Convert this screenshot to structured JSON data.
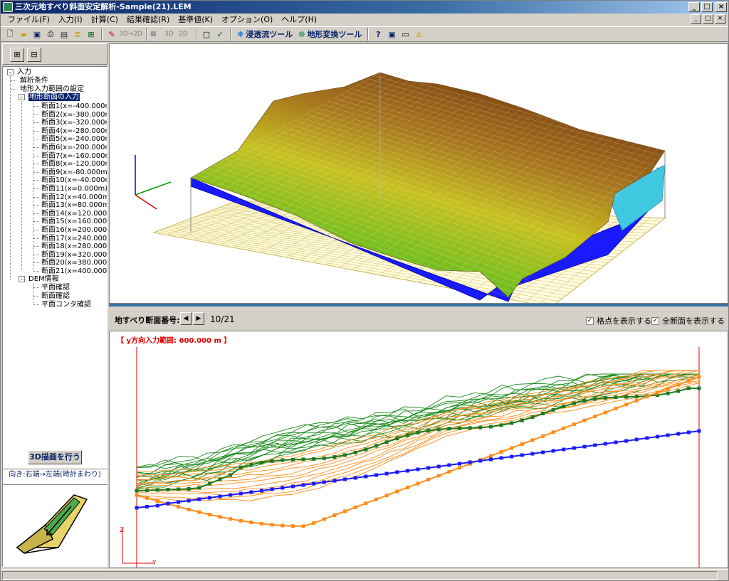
{
  "window": {
    "title": "三次元地すべり斜面安定解析-Sample(21).LEM"
  },
  "menu": [
    "ファイル(F)",
    "入力(I)",
    "計算(C)",
    "結果確認(R)",
    "基準値(K)",
    "オプション(O)",
    "ヘルプ(H)"
  ],
  "toolbar": {
    "seepage_tool": "浸透流ツール",
    "terrain_tool": "地形変換ツール",
    "view_3d2d": "3D→2D",
    "view_3d": "3D",
    "view_2d": "2D"
  },
  "tree": {
    "root": "入力",
    "analysis_conditions": "解析条件",
    "terrain_range": "地形入力範囲の設定",
    "terrain_section_input": "地形断面の入力",
    "sections": [
      "断面1(x=-400.000m)",
      "断面2(x=-380.000m)",
      "断面3(x=-320.000m)",
      "断面4(x=-280.000m)",
      "断面5(x=-240.000m)",
      "断面6(x=-200.000m)",
      "断面7(x=-160.000m)",
      "断面8(x=-120.000m)",
      "断面9(x=-80.000m)",
      "断面10(x=-40.000m)",
      "断面11(x=0.000m)",
      "断面12(x=40.000m)",
      "断面13(x=80.000m)",
      "断面14(x=120.000m)",
      "断面15(x=160.000m)",
      "断面16(x=200.000m)",
      "断面17(x=240.000m)",
      "断面18(x=280.000m)",
      "断面19(x=320.000m)",
      "断面20(x=380.000m)",
      "断面21(x=400.000m)"
    ],
    "dem_info": "DEM情報",
    "plane_check": "平面確認",
    "section_check": "断面確認",
    "contour_check": "平面コンタ確認"
  },
  "left": {
    "draw3d_button": "3D描画を行う",
    "direction_label": "向き:右端→左端(時計まわり)"
  },
  "section_bar": {
    "label": "地すべり断面番号:",
    "count": "10/21",
    "show_grid_points": "格点を表示する",
    "show_all_sections": "全断面を表示する"
  },
  "view2d": {
    "y_range_text": "【 y方向入力範囲:   600.000 m 】",
    "axis_z": "Z",
    "axis_y": "Y"
  },
  "colors": {
    "title_blue": "#0a246a",
    "selection": "#0a246a",
    "ground_green": "#1e8c1e",
    "slip_orange": "#ff8c1a",
    "water_blue": "#1a1aff",
    "range_red": "#e00000"
  }
}
